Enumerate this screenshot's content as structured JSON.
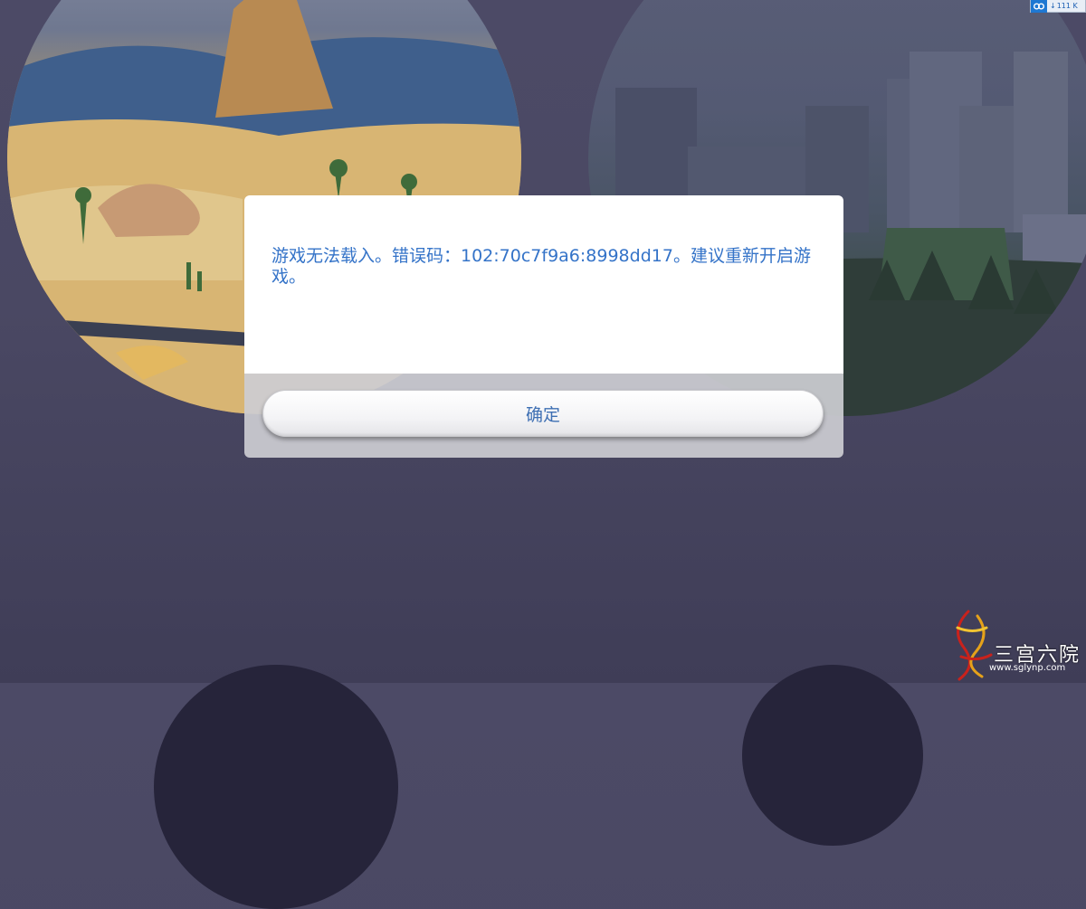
{
  "dialog": {
    "message": "游戏无法载入。错误码：102:70c7f9a6:8998dd17。建议重新开启游戏。",
    "confirm_label": "确定"
  },
  "tray": {
    "speed_text": "111 K"
  },
  "watermark": {
    "brand_text": "三宫六院",
    "url": "www.sglynp.com"
  },
  "colors": {
    "background": "#4a4863",
    "message_text": "#3473c8",
    "button_text": "#3e6fb3"
  },
  "icons": [
    "cloud-sync-icon",
    "download-arrow-icon",
    "phoenix-logo-icon"
  ]
}
